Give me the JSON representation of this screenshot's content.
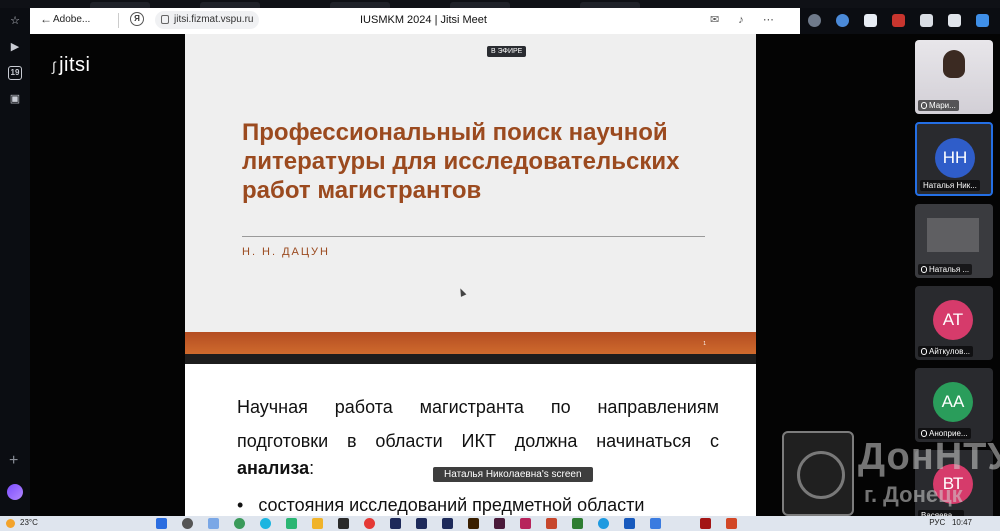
{
  "browser": {
    "tab_label": "Adobe...",
    "url": "jitsi.fizmat.vspu.ru",
    "page_title": "IUSMKM 2024 | Jitsi Meet",
    "rail_badge": "19"
  },
  "jitsi": {
    "logo_text": "jitsi",
    "live_badge": "В ЭФИРЕ",
    "screen_share_label": "Наталья Николаевна's screen"
  },
  "slide1": {
    "title": "Профессиональный поиск научной литературы для исследовательских работ магистрантов",
    "author": "Н. Н. ДАЦУН",
    "page_number": "1"
  },
  "slide2": {
    "paragraph": "Научная работа магистранта по направлениям подготовки в области ИКТ должна начинаться с",
    "bold_word": "анализа",
    "after_bold": ":",
    "bullet": "состояния исследований предметной области"
  },
  "participants": [
    {
      "name": "Мари...",
      "type": "video"
    },
    {
      "initials": "НН",
      "name": "Наталья Ник...",
      "color": "#2f5dc9",
      "active": true
    },
    {
      "name": "Наталья ...",
      "type": "screen"
    },
    {
      "initials": "АТ",
      "name": "Айткулов...",
      "color": "#d63b6b"
    },
    {
      "initials": "АА",
      "name": "Аноприе...",
      "color": "#2a9d5b"
    },
    {
      "initials": "ВТ",
      "name": "Васяева ...",
      "color": "#d63b6b"
    }
  ],
  "watermark": {
    "text": "ДонНТУ",
    "subtext": "г. Донецк"
  },
  "taskbar": {
    "temperature": "23°C",
    "clock": "10:47",
    "lang": "РУС"
  }
}
